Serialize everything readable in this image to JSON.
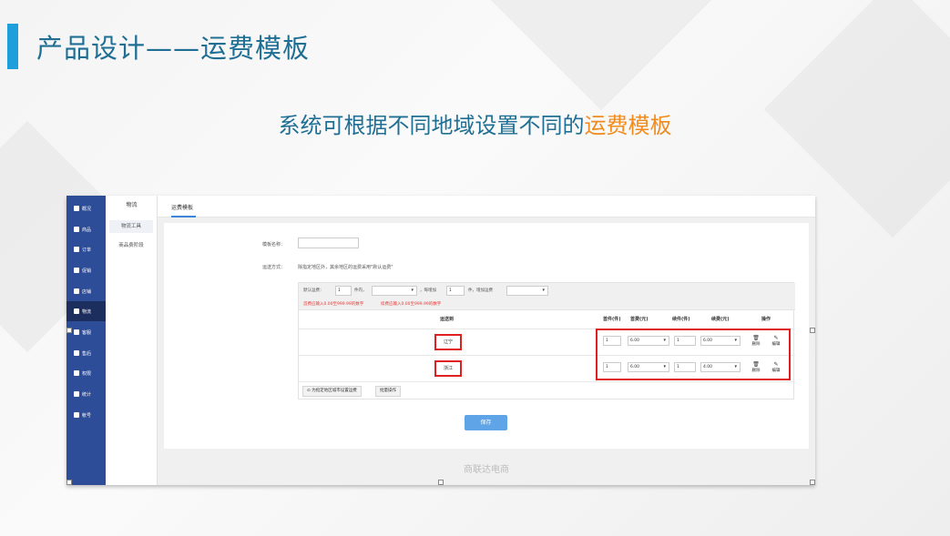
{
  "slide": {
    "title": "产品设计——运费模板",
    "subtitle_main": "系统可根据不同地域设置不同的",
    "subtitle_highlight": "运费模板"
  },
  "sidebar": {
    "items": [
      {
        "label": "概况",
        "icon": "home-icon"
      },
      {
        "label": "商品",
        "icon": "goods-icon"
      },
      {
        "label": "订单",
        "icon": "order-icon"
      },
      {
        "label": "促销",
        "icon": "promo-icon"
      },
      {
        "label": "店铺",
        "icon": "shop-icon"
      },
      {
        "label": "物流",
        "icon": "truck-icon",
        "active": true
      },
      {
        "label": "客服",
        "icon": "chat-icon"
      },
      {
        "label": "售后",
        "icon": "wrench-icon"
      },
      {
        "label": "权限",
        "icon": "permission-icon"
      },
      {
        "label": "统计",
        "icon": "stats-icon"
      },
      {
        "label": "帐号",
        "icon": "account-icon"
      }
    ]
  },
  "submenu": {
    "header": "物流",
    "items": [
      "物流工具",
      "商品费阶段"
    ]
  },
  "topnav": {
    "tab": "运费模板"
  },
  "form": {
    "template_name_label": "模板名称：",
    "template_name_value": "",
    "shipping_method_label": "运送方式：",
    "shipping_method_hint": "除指定地区外，其余地区的运费采用\"默认运费\"",
    "default_row": {
      "prefix": "默认运费：",
      "first_qty": "1",
      "unit_text": "件内，",
      "first_fee": "",
      "each_add_text": "，每增加",
      "add_qty": "1",
      "add_unit_text": "件，增加运费",
      "add_fee": ""
    },
    "red_note_1": "首费应输入0.00至999.99的数字",
    "red_note_2": "续费应输入0.00至999.99的数字"
  },
  "table": {
    "headers": {
      "region": "运送到",
      "first_qty": "首件(件)",
      "first_fee": "首费(元)",
      "add_qty": "续件(件)",
      "add_fee": "续费(元)",
      "action": "操作"
    },
    "rows": [
      {
        "region": "辽宁",
        "first_qty": "1",
        "first_fee": "6.00",
        "add_qty": "1",
        "add_fee": "6.00",
        "delete": "删除",
        "edit": "编辑"
      },
      {
        "region": "浙江",
        "first_qty": "1",
        "first_fee": "6.00",
        "add_qty": "1",
        "add_fee": "4.00",
        "delete": "删除",
        "edit": "编辑"
      }
    ],
    "add_region_button": "为指定地区城市设置运费",
    "batch_button": "批量操作"
  },
  "save_button": "保存",
  "footer_brand": "商联达电商"
}
